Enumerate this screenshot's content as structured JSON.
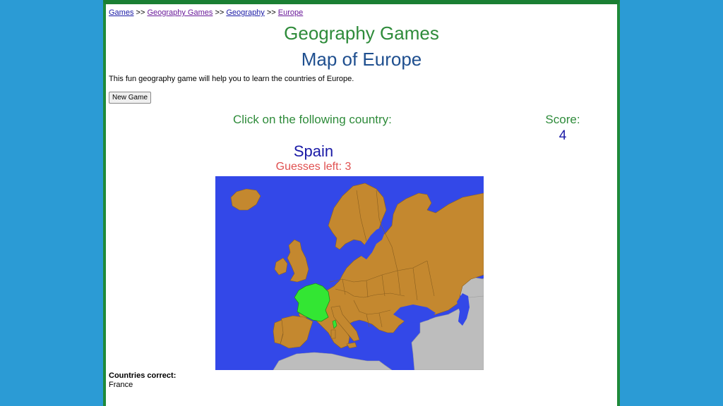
{
  "breadcrumb": {
    "items": [
      "Games",
      "Geography Games",
      "Geography",
      "Europe"
    ],
    "separator": ">>"
  },
  "header": {
    "title": "Geography Games",
    "subtitle": "Map of Europe"
  },
  "intro": "This fun geography game will help you to learn the countries of Europe.",
  "buttons": {
    "new_game": "New Game"
  },
  "game": {
    "prompt": "Click on the following country:",
    "target_country": "Spain",
    "guesses_left_text": "Guesses left: 3",
    "score_label": "Score:",
    "score_value": "4"
  },
  "countries_correct": {
    "label": "Countries correct:",
    "items": [
      "France"
    ]
  },
  "colors": {
    "sea": "#3348e8",
    "land": "#c4882f",
    "non_europe": "#bdbdbd",
    "correct": "#33e633",
    "border": "#1f8a3a",
    "background": "#2b9bd5"
  }
}
